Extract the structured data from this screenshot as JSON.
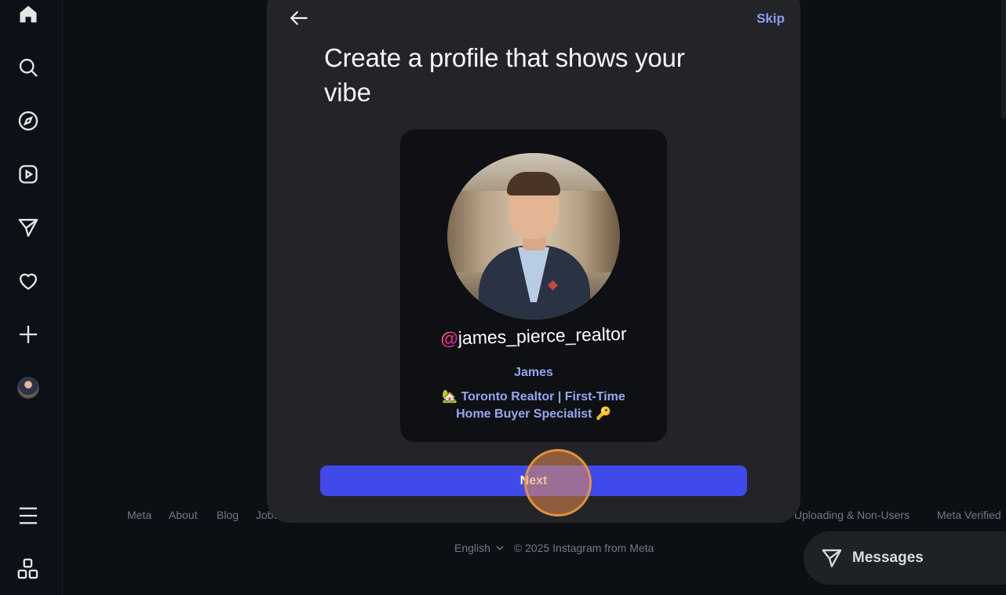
{
  "nav": {
    "items": [
      {
        "name": "home",
        "icon": "home-icon"
      },
      {
        "name": "search",
        "icon": "search-icon"
      },
      {
        "name": "explore",
        "icon": "compass-icon"
      },
      {
        "name": "reels",
        "icon": "reels-icon"
      },
      {
        "name": "messages",
        "icon": "send-icon"
      },
      {
        "name": "notifications",
        "icon": "heart-icon"
      },
      {
        "name": "create",
        "icon": "plus-icon"
      },
      {
        "name": "profile",
        "icon": "avatar"
      }
    ],
    "bottom": [
      {
        "name": "more",
        "icon": "menu-icon"
      },
      {
        "name": "also-from-meta",
        "icon": "grid-icon"
      }
    ]
  },
  "modal": {
    "back_icon": "arrow-left-icon",
    "skip_label": "Skip",
    "title": "Create a profile that shows your vibe",
    "card": {
      "at_symbol": "@",
      "handle": "james_pierce_realtor",
      "display_name": "James",
      "bio_line1": "🏡 Toronto Realtor | First-Time",
      "bio_line2": "Home Buyer Specialist 🔑"
    },
    "next_label": "Next"
  },
  "footer": {
    "links": [
      "Meta",
      "About",
      "Blog",
      "Jobs",
      "Uploading & Non-Users",
      "Meta Verified"
    ],
    "language": "English",
    "copyright": "© 2025 Instagram from Meta"
  },
  "messages_pill": {
    "label": "Messages",
    "icon": "send-icon"
  },
  "colors": {
    "accent": "#4049ea",
    "link": "#8b9cf2",
    "modal_bg": "#232428",
    "page_bg": "#0c0f14"
  }
}
